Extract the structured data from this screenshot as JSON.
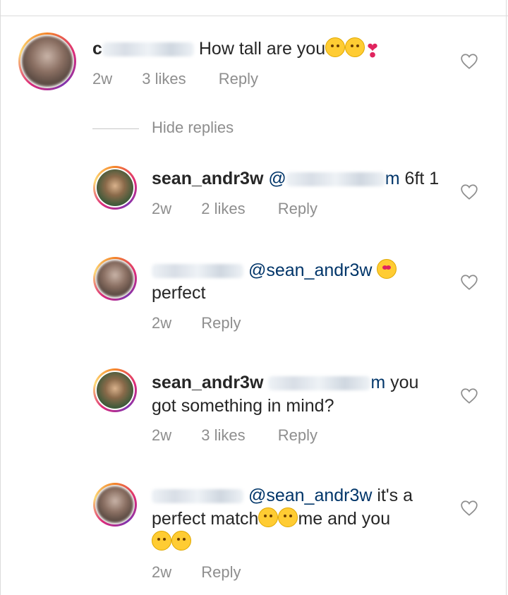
{
  "comments": [
    {
      "id": "c1",
      "username_visible": "c",
      "text": "How tall are you",
      "emojis": [
        "smiling-face-emoji",
        "hugging-face-emoji",
        "heart-exclamation-emoji"
      ],
      "time": "2w",
      "likes": "3 likes",
      "reply_label": "Reply",
      "hide_replies_label": "Hide replies"
    }
  ],
  "replies": [
    {
      "id": "r1",
      "username": "sean_andr3w",
      "mention_prefix": "@",
      "mention_suffix": "m",
      "text": "6ft 1",
      "time": "2w",
      "likes": "2 likes",
      "reply_label": "Reply"
    },
    {
      "id": "r2",
      "username_visible": "",
      "mention": "@sean_andr3w",
      "text": "perfect",
      "emojis": [
        "heart-eyes-emoji"
      ],
      "time": "2w",
      "reply_label": "Reply"
    },
    {
      "id": "r3",
      "username": "sean_andr3w",
      "mention_suffix": "m",
      "text_line1": "you",
      "text_line2": "got something in mind?",
      "time": "2w",
      "likes": "3 likes",
      "reply_label": "Reply"
    },
    {
      "id": "r4",
      "username_visible": "",
      "mention": "@sean_andr3w",
      "text_line1": "it's a",
      "text_line2a": "perfect match",
      "text_line2b": "me and you",
      "emojis": [
        "tears-of-joy-emoji",
        "smiling-face-emoji",
        "eye-roll-emoji",
        "tears-of-joy-emoji"
      ],
      "time": "2w",
      "reply_label": "Reply"
    }
  ],
  "icons": {
    "like": "heart-outline-icon"
  },
  "colors": {
    "text": "#262626",
    "muted": "#8e8e8e",
    "mention": "#003569",
    "heart_stroke": "#8e8e8e"
  }
}
